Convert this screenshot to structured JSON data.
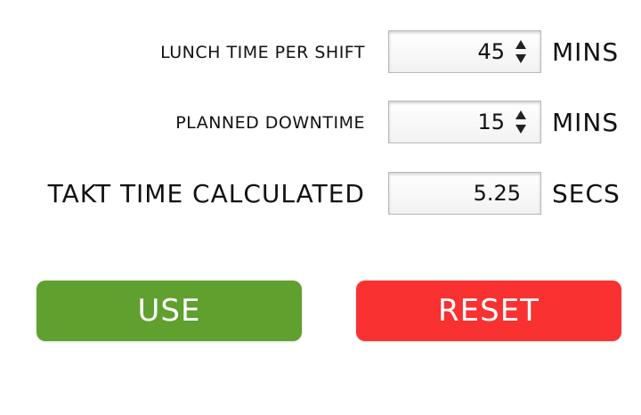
{
  "form": {
    "rows": [
      {
        "label": "Lunch time per shift",
        "value": "45",
        "unit": "Mins"
      },
      {
        "label": "Planned downtime",
        "value": "15",
        "unit": "Mins"
      },
      {
        "label": "Takt time calculated",
        "value": "5.25",
        "unit": "Secs"
      }
    ]
  },
  "buttons": {
    "use_label": "Use",
    "reset_label": "Reset"
  },
  "colors": {
    "use": "#5fa02f",
    "reset": "#f93131"
  },
  "icons": {
    "spinner": "up-down-stepper-arrows"
  }
}
